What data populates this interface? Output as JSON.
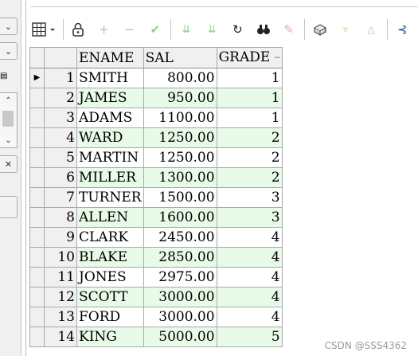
{
  "toolbar": {
    "grid_menu": "grid-menu-icon",
    "icons": [
      "lock-icon",
      "add-icon",
      "remove-icon",
      "post-icon",
      "filter-icon",
      "sort-icon",
      "refresh-icon",
      "find-icon",
      "clear-icon",
      "export-icon",
      "move-down-icon",
      "move-up-icon",
      "link-icon"
    ]
  },
  "columns": [
    "ENAME",
    "SAL",
    "GRADE"
  ],
  "rows": [
    {
      "n": "1",
      "ename": "SMITH",
      "sal": "800.00",
      "grade": "1"
    },
    {
      "n": "2",
      "ename": "JAMES",
      "sal": "950.00",
      "grade": "1"
    },
    {
      "n": "3",
      "ename": "ADAMS",
      "sal": "1100.00",
      "grade": "1"
    },
    {
      "n": "4",
      "ename": "WARD",
      "sal": "1250.00",
      "grade": "2"
    },
    {
      "n": "5",
      "ename": "MARTIN",
      "sal": "1250.00",
      "grade": "2"
    },
    {
      "n": "6",
      "ename": "MILLER",
      "sal": "1300.00",
      "grade": "2"
    },
    {
      "n": "7",
      "ename": "TURNER",
      "sal": "1500.00",
      "grade": "3"
    },
    {
      "n": "8",
      "ename": "ALLEN",
      "sal": "1600.00",
      "grade": "3"
    },
    {
      "n": "9",
      "ename": "CLARK",
      "sal": "2450.00",
      "grade": "4"
    },
    {
      "n": "10",
      "ename": "BLAKE",
      "sal": "2850.00",
      "grade": "4"
    },
    {
      "n": "11",
      "ename": "JONES",
      "sal": "2975.00",
      "grade": "4"
    },
    {
      "n": "12",
      "ename": "SCOTT",
      "sal": "3000.00",
      "grade": "4"
    },
    {
      "n": "13",
      "ename": "FORD",
      "sal": "3000.00",
      "grade": "4"
    },
    {
      "n": "14",
      "ename": "KING",
      "sal": "5000.00",
      "grade": "5"
    }
  ],
  "watermark": "CSDN @SSS4362",
  "colors": {
    "alt_row": "#e8fae8",
    "header": "#f0f0f0"
  }
}
